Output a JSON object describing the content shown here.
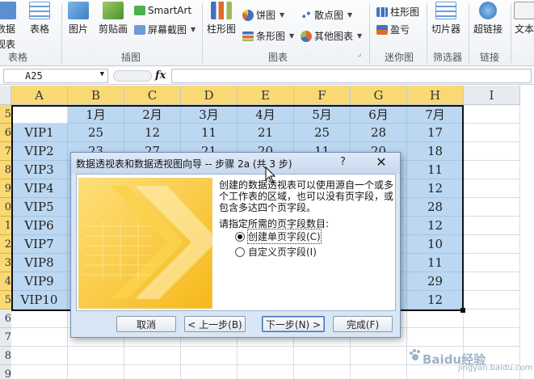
{
  "ribbon": {
    "groups": [
      {
        "label": "表格",
        "items": [
          "数据",
          "表格",
          "视表"
        ]
      },
      {
        "label": "插图",
        "items": [
          "图片",
          "剪贴画",
          "SmartArt",
          "屏幕截图"
        ]
      },
      {
        "label": "图表",
        "items": [
          "柱形图",
          "饼图",
          "条形图",
          "散点图",
          "其他图表"
        ]
      },
      {
        "label": "迷你图",
        "items": [
          "柱形图",
          "盈亏"
        ]
      },
      {
        "label": "筛选器",
        "items": [
          "切片器"
        ]
      },
      {
        "label": "链接",
        "items": [
          "超链接"
        ]
      },
      {
        "label": "",
        "items": [
          "文本"
        ]
      }
    ]
  },
  "formula_bar": {
    "name_box": "A25",
    "fx_label": "fx",
    "formula": ""
  },
  "sheet": {
    "columns": [
      "A",
      "B",
      "C",
      "D",
      "E",
      "F",
      "G",
      "H",
      "I"
    ],
    "row_numbers": [
      "5",
      "6",
      "7",
      "8",
      "9",
      "0",
      "1",
      "2",
      "3",
      "4",
      "5",
      "6",
      "7",
      "8",
      "9"
    ],
    "header_row": [
      "",
      "1月",
      "2月",
      "3月",
      "4月",
      "5月",
      "6月",
      "7月"
    ],
    "rows": [
      [
        "VIP1",
        "25",
        "12",
        "11",
        "21",
        "25",
        "28",
        "17"
      ],
      [
        "VIP2",
        "23",
        "27",
        "21",
        "20",
        "11",
        "20",
        "18"
      ],
      [
        "VIP3",
        "",
        "",
        "",
        "",
        "",
        "",
        "11"
      ],
      [
        "VIP4",
        "",
        "",
        "",
        "",
        "",
        "",
        "12"
      ],
      [
        "VIP5",
        "",
        "",
        "",
        "",
        "",
        "",
        "28"
      ],
      [
        "VIP6",
        "",
        "",
        "",
        "",
        "",
        "",
        "12"
      ],
      [
        "VIP7",
        "",
        "",
        "",
        "",
        "",
        "",
        "10"
      ],
      [
        "VIP8",
        "",
        "",
        "",
        "",
        "",
        "",
        "11"
      ],
      [
        "VIP9",
        "",
        "",
        "",
        "",
        "",
        "",
        "29"
      ],
      [
        "VIP10",
        "",
        "",
        "",
        "",
        "",
        "",
        "12"
      ]
    ]
  },
  "dialog": {
    "title": "数据透视表和数据透视图向导 -- 步骤 2a (共 3 步)",
    "help": "?",
    "close": "✕",
    "description": "创建的数据透视表可以使用源自一个或多个工作表的区域，也可以没有页字段，或包含多达四个页字段。",
    "prompt": "请指定所需的页字段数目:",
    "options": [
      "创建单页字段(C)",
      "自定义页字段(I)"
    ],
    "selected_option": 0,
    "buttons": {
      "cancel": "取消",
      "back": "< 上一步(B)",
      "next": "下一步(N) >",
      "finish": "完成(F)"
    }
  },
  "watermark": {
    "brand": "Baidu经验",
    "url": "jingyan.baidu.com"
  },
  "colors": {
    "selection": "#bcd7f1",
    "header_highlight": "#f9d976",
    "dialog_bg": "#d9e6f5",
    "accent_yellow": "#f6c624"
  }
}
